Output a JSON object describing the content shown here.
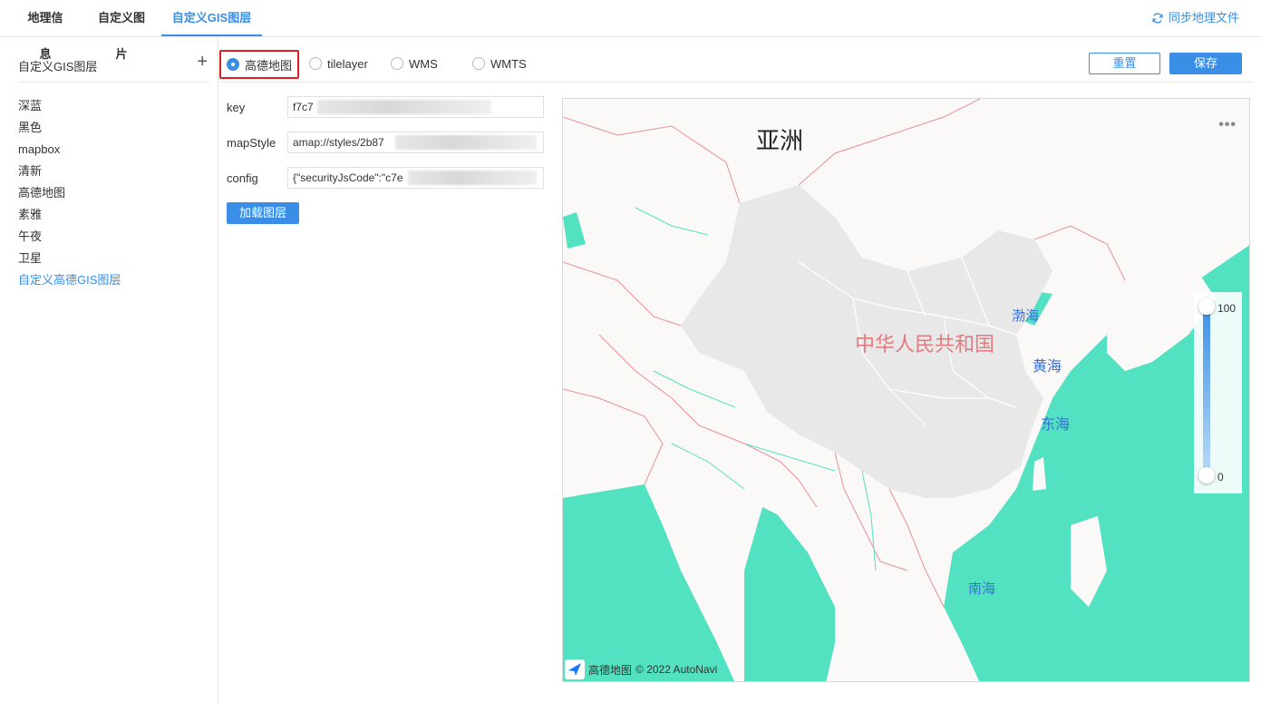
{
  "top_tabs": [
    {
      "label": "地理信息"
    },
    {
      "label": "自定义图片"
    },
    {
      "label": "自定义GIS图层"
    }
  ],
  "sync_label": "同步地理文件",
  "sidebar": {
    "title": "自定义GIS图层",
    "add_icon": "plus-icon",
    "items": [
      {
        "label": "深蓝"
      },
      {
        "label": "黑色"
      },
      {
        "label": "mapbox"
      },
      {
        "label": "清新"
      },
      {
        "label": "高德地图"
      },
      {
        "label": "素雅"
      },
      {
        "label": "午夜"
      },
      {
        "label": "卫星"
      },
      {
        "label": "自定义高德GIS图层"
      }
    ]
  },
  "layer_types": [
    {
      "label": "高德地图",
      "checked": true
    },
    {
      "label": "tilelayer",
      "checked": false
    },
    {
      "label": "WMS",
      "checked": false
    },
    {
      "label": "WMTS",
      "checked": false
    }
  ],
  "buttons": {
    "reset": "重置",
    "save": "保存",
    "load": "加载图层"
  },
  "form": {
    "key": {
      "label": "key",
      "value": "f7c7"
    },
    "mapStyle": {
      "label": "mapStyle",
      "value": "amap://styles/2b87"
    },
    "config": {
      "label": "config",
      "value": "{\"securityJsCode\":\"c7e"
    }
  },
  "map": {
    "labels": {
      "asia": "亚洲",
      "china": "中华人民共和国",
      "bohai": "渤海",
      "huanghai": "黄海",
      "donghai": "东海",
      "nanhai": "南海"
    },
    "more_icon": "more-dots-icon",
    "legend_max": "100",
    "legend_min": "0",
    "attribution_logo": "高德地图",
    "attribution_text": "© 2022 AutoNavi",
    "colors": {
      "sea": "#52e2c1",
      "land": "#fbf9f7",
      "china": "#e8e8e8",
      "border": "#e88f96",
      "accent": "#3a8ee6"
    }
  }
}
